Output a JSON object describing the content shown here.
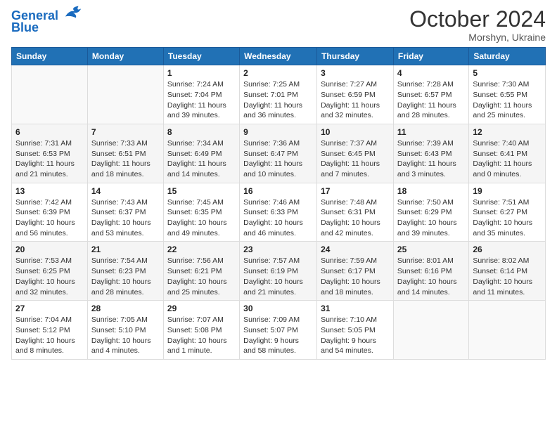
{
  "header": {
    "logo_line1": "General",
    "logo_line2": "Blue",
    "main_title": "October 2024",
    "subtitle": "Morshyn, Ukraine"
  },
  "weekdays": [
    "Sunday",
    "Monday",
    "Tuesday",
    "Wednesday",
    "Thursday",
    "Friday",
    "Saturday"
  ],
  "weeks": [
    [
      {
        "day": "",
        "sunrise": "",
        "sunset": "",
        "daylight": ""
      },
      {
        "day": "",
        "sunrise": "",
        "sunset": "",
        "daylight": ""
      },
      {
        "day": "1",
        "sunrise": "Sunrise: 7:24 AM",
        "sunset": "Sunset: 7:04 PM",
        "daylight": "Daylight: 11 hours and 39 minutes."
      },
      {
        "day": "2",
        "sunrise": "Sunrise: 7:25 AM",
        "sunset": "Sunset: 7:01 PM",
        "daylight": "Daylight: 11 hours and 36 minutes."
      },
      {
        "day": "3",
        "sunrise": "Sunrise: 7:27 AM",
        "sunset": "Sunset: 6:59 PM",
        "daylight": "Daylight: 11 hours and 32 minutes."
      },
      {
        "day": "4",
        "sunrise": "Sunrise: 7:28 AM",
        "sunset": "Sunset: 6:57 PM",
        "daylight": "Daylight: 11 hours and 28 minutes."
      },
      {
        "day": "5",
        "sunrise": "Sunrise: 7:30 AM",
        "sunset": "Sunset: 6:55 PM",
        "daylight": "Daylight: 11 hours and 25 minutes."
      }
    ],
    [
      {
        "day": "6",
        "sunrise": "Sunrise: 7:31 AM",
        "sunset": "Sunset: 6:53 PM",
        "daylight": "Daylight: 11 hours and 21 minutes."
      },
      {
        "day": "7",
        "sunrise": "Sunrise: 7:33 AM",
        "sunset": "Sunset: 6:51 PM",
        "daylight": "Daylight: 11 hours and 18 minutes."
      },
      {
        "day": "8",
        "sunrise": "Sunrise: 7:34 AM",
        "sunset": "Sunset: 6:49 PM",
        "daylight": "Daylight: 11 hours and 14 minutes."
      },
      {
        "day": "9",
        "sunrise": "Sunrise: 7:36 AM",
        "sunset": "Sunset: 6:47 PM",
        "daylight": "Daylight: 11 hours and 10 minutes."
      },
      {
        "day": "10",
        "sunrise": "Sunrise: 7:37 AM",
        "sunset": "Sunset: 6:45 PM",
        "daylight": "Daylight: 11 hours and 7 minutes."
      },
      {
        "day": "11",
        "sunrise": "Sunrise: 7:39 AM",
        "sunset": "Sunset: 6:43 PM",
        "daylight": "Daylight: 11 hours and 3 minutes."
      },
      {
        "day": "12",
        "sunrise": "Sunrise: 7:40 AM",
        "sunset": "Sunset: 6:41 PM",
        "daylight": "Daylight: 11 hours and 0 minutes."
      }
    ],
    [
      {
        "day": "13",
        "sunrise": "Sunrise: 7:42 AM",
        "sunset": "Sunset: 6:39 PM",
        "daylight": "Daylight: 10 hours and 56 minutes."
      },
      {
        "day": "14",
        "sunrise": "Sunrise: 7:43 AM",
        "sunset": "Sunset: 6:37 PM",
        "daylight": "Daylight: 10 hours and 53 minutes."
      },
      {
        "day": "15",
        "sunrise": "Sunrise: 7:45 AM",
        "sunset": "Sunset: 6:35 PM",
        "daylight": "Daylight: 10 hours and 49 minutes."
      },
      {
        "day": "16",
        "sunrise": "Sunrise: 7:46 AM",
        "sunset": "Sunset: 6:33 PM",
        "daylight": "Daylight: 10 hours and 46 minutes."
      },
      {
        "day": "17",
        "sunrise": "Sunrise: 7:48 AM",
        "sunset": "Sunset: 6:31 PM",
        "daylight": "Daylight: 10 hours and 42 minutes."
      },
      {
        "day": "18",
        "sunrise": "Sunrise: 7:50 AM",
        "sunset": "Sunset: 6:29 PM",
        "daylight": "Daylight: 10 hours and 39 minutes."
      },
      {
        "day": "19",
        "sunrise": "Sunrise: 7:51 AM",
        "sunset": "Sunset: 6:27 PM",
        "daylight": "Daylight: 10 hours and 35 minutes."
      }
    ],
    [
      {
        "day": "20",
        "sunrise": "Sunrise: 7:53 AM",
        "sunset": "Sunset: 6:25 PM",
        "daylight": "Daylight: 10 hours and 32 minutes."
      },
      {
        "day": "21",
        "sunrise": "Sunrise: 7:54 AM",
        "sunset": "Sunset: 6:23 PM",
        "daylight": "Daylight: 10 hours and 28 minutes."
      },
      {
        "day": "22",
        "sunrise": "Sunrise: 7:56 AM",
        "sunset": "Sunset: 6:21 PM",
        "daylight": "Daylight: 10 hours and 25 minutes."
      },
      {
        "day": "23",
        "sunrise": "Sunrise: 7:57 AM",
        "sunset": "Sunset: 6:19 PM",
        "daylight": "Daylight: 10 hours and 21 minutes."
      },
      {
        "day": "24",
        "sunrise": "Sunrise: 7:59 AM",
        "sunset": "Sunset: 6:17 PM",
        "daylight": "Daylight: 10 hours and 18 minutes."
      },
      {
        "day": "25",
        "sunrise": "Sunrise: 8:01 AM",
        "sunset": "Sunset: 6:16 PM",
        "daylight": "Daylight: 10 hours and 14 minutes."
      },
      {
        "day": "26",
        "sunrise": "Sunrise: 8:02 AM",
        "sunset": "Sunset: 6:14 PM",
        "daylight": "Daylight: 10 hours and 11 minutes."
      }
    ],
    [
      {
        "day": "27",
        "sunrise": "Sunrise: 7:04 AM",
        "sunset": "Sunset: 5:12 PM",
        "daylight": "Daylight: 10 hours and 8 minutes."
      },
      {
        "day": "28",
        "sunrise": "Sunrise: 7:05 AM",
        "sunset": "Sunset: 5:10 PM",
        "daylight": "Daylight: 10 hours and 4 minutes."
      },
      {
        "day": "29",
        "sunrise": "Sunrise: 7:07 AM",
        "sunset": "Sunset: 5:08 PM",
        "daylight": "Daylight: 10 hours and 1 minute."
      },
      {
        "day": "30",
        "sunrise": "Sunrise: 7:09 AM",
        "sunset": "Sunset: 5:07 PM",
        "daylight": "Daylight: 9 hours and 58 minutes."
      },
      {
        "day": "31",
        "sunrise": "Sunrise: 7:10 AM",
        "sunset": "Sunset: 5:05 PM",
        "daylight": "Daylight: 9 hours and 54 minutes."
      },
      {
        "day": "",
        "sunrise": "",
        "sunset": "",
        "daylight": ""
      },
      {
        "day": "",
        "sunrise": "",
        "sunset": "",
        "daylight": ""
      }
    ]
  ]
}
